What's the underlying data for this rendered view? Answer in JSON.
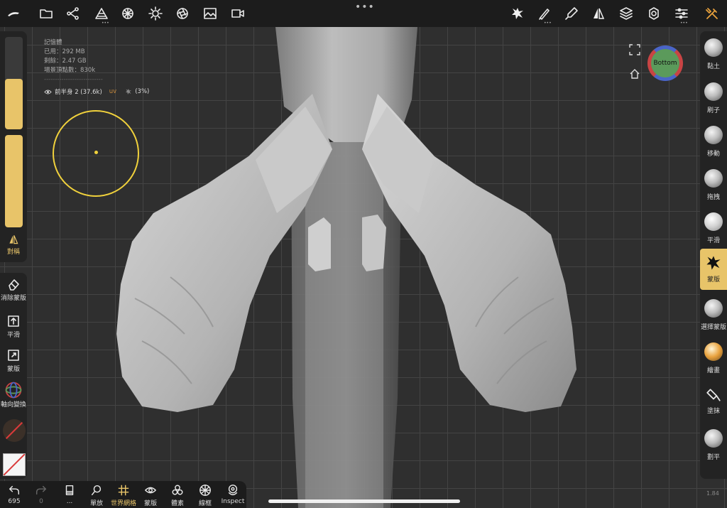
{
  "app": {
    "accent_color": "#e8c469"
  },
  "topbar": {
    "left_icons": [
      "logo-icon",
      "folder-icon",
      "scene-graph-icon",
      "topology-icon",
      "material-icon",
      "light-icon",
      "post-process-icon",
      "background-icon",
      "video-icon"
    ],
    "right_icons": [
      "mask-tool-icon",
      "brush-settings-icon",
      "picker-icon",
      "symmetry-icon",
      "layers-icon",
      "settings-icon",
      "sliders-icon",
      "tools-icon"
    ],
    "center_dots": "•••"
  },
  "stats": {
    "title": "記憶體",
    "used": "已用：292 MB",
    "free": "剩餘：2.47 GB",
    "vertices": "場景頂點數：830k",
    "separator": "---------------------------"
  },
  "mesh": {
    "name": "前半身 2 (37.6k)",
    "uv_label": "uv",
    "percent": "(3%)"
  },
  "left_panel": {
    "radius_level": 0.55,
    "intensity_level": 1.0,
    "symmetry_label": "對稱"
  },
  "left_tools": [
    {
      "label": "消除蒙版",
      "icon": "eraser-icon"
    },
    {
      "label": "平滑",
      "icon": "smooth-box-icon"
    },
    {
      "label": "蒙版",
      "icon": "mask-box-icon"
    },
    {
      "label": "軸向變換",
      "icon": "gizmo-icon"
    }
  ],
  "bottom_bar": {
    "undo_count": "695",
    "redo_count": "0",
    "more": "...",
    "items": [
      {
        "label": "單放",
        "icon": "solo-icon"
      },
      {
        "label": "世界網格",
        "icon": "grid-icon",
        "active": true
      },
      {
        "label": "蒙版",
        "icon": "eye-icon"
      },
      {
        "label": "體素",
        "icon": "voxel-icon"
      },
      {
        "label": "線框",
        "icon": "wireframe-icon"
      },
      {
        "label": "Inspect",
        "icon": "inspect-icon"
      }
    ]
  },
  "right_tools": [
    {
      "label": "黏土",
      "active": false
    },
    {
      "label": "刷子",
      "active": false
    },
    {
      "label": "移動",
      "active": false
    },
    {
      "label": "拖拽",
      "active": false
    },
    {
      "label": "平滑",
      "active": false
    },
    {
      "label": "蒙版",
      "active": true
    },
    {
      "label": "選擇蒙版",
      "active": false
    },
    {
      "label": "繪畫",
      "active": false
    },
    {
      "label": "塗抹",
      "active": false
    },
    {
      "label": "劃平",
      "active": false
    }
  ],
  "gizmo": {
    "label": "Bottom"
  },
  "version": "1.84"
}
